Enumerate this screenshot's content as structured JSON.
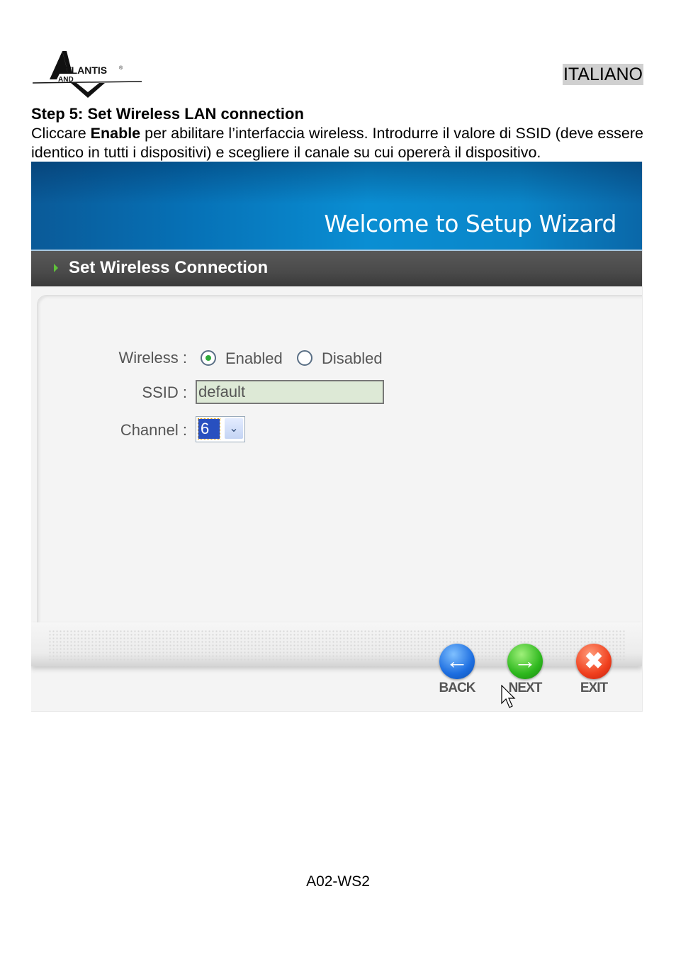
{
  "header": {
    "logo_text": "ATLANTIS AND",
    "language": "ITALIANO"
  },
  "step": {
    "title": "Step 5: Set Wireless LAN connection",
    "desc_pre": "Cliccare ",
    "desc_bold": "Enable",
    "desc_post": " per abilitare l’interfaccia wireless. Introdurre il valore di SSID (deve essere identico in tutti i dispositivi) e scegliere il canale su cui opererà il dispositivo."
  },
  "wizard": {
    "banner_title": "Welcome to Setup Wizard",
    "section_title": "Set Wireless Connection",
    "wireless_label": "Wireless :",
    "wireless_options": [
      "Enabled",
      "Disabled"
    ],
    "wireless_selected": "Enabled",
    "ssid_label": "SSID :",
    "ssid_value": "default",
    "channel_label": "Channel :",
    "channel_value": "6",
    "buttons": {
      "back": "BACK",
      "next": "NEXT",
      "exit": "EXIT"
    },
    "colors": {
      "banner": "#0a86c9",
      "section_bar": "#4a4a4a",
      "ssid_bg": "#dde9d6"
    }
  },
  "footer": {
    "model": "A02-WS2"
  }
}
